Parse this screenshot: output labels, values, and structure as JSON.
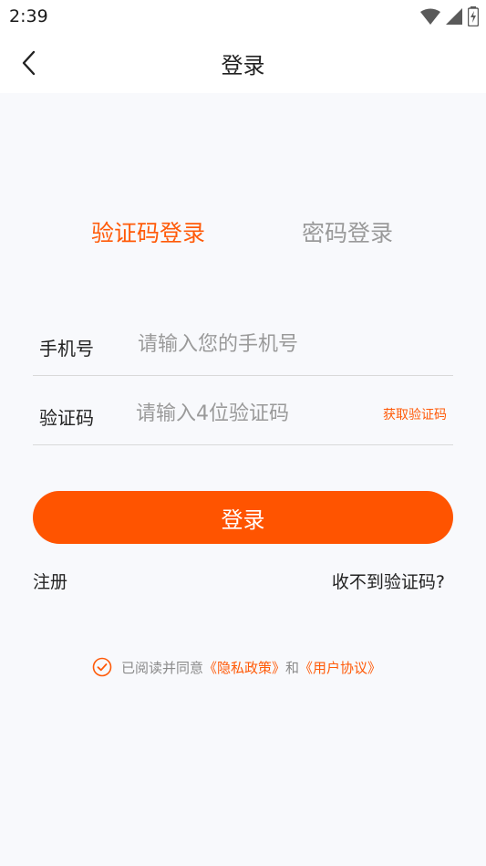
{
  "status_bar": {
    "time": "2:39",
    "icons": [
      "wifi-icon",
      "signal-icon",
      "battery-icon"
    ]
  },
  "nav": {
    "title": "登录",
    "back_icon": "chevron-left-icon"
  },
  "tabs": [
    {
      "label": "验证码登录",
      "active": true
    },
    {
      "label": "密码登录",
      "active": false
    }
  ],
  "form": {
    "phone": {
      "label": "手机号",
      "value": "",
      "placeholder": "请输入您的手机号"
    },
    "code": {
      "label": "验证码",
      "value": "",
      "placeholder": "请输入4位验证码",
      "action": "获取验证码"
    }
  },
  "login_button": "登录",
  "links": {
    "register": "注册",
    "no_code": "收不到验证码?"
  },
  "agreement": {
    "checked": true,
    "prefix": "已阅读并同意",
    "privacy": "《隐私政策》",
    "conjunction": "和",
    "user_agreement": "《用户协议》"
  },
  "colors": {
    "accent": "#ff5400",
    "text": "#222222",
    "placeholder": "#9a9a9a",
    "background": "#f8f9fc"
  }
}
